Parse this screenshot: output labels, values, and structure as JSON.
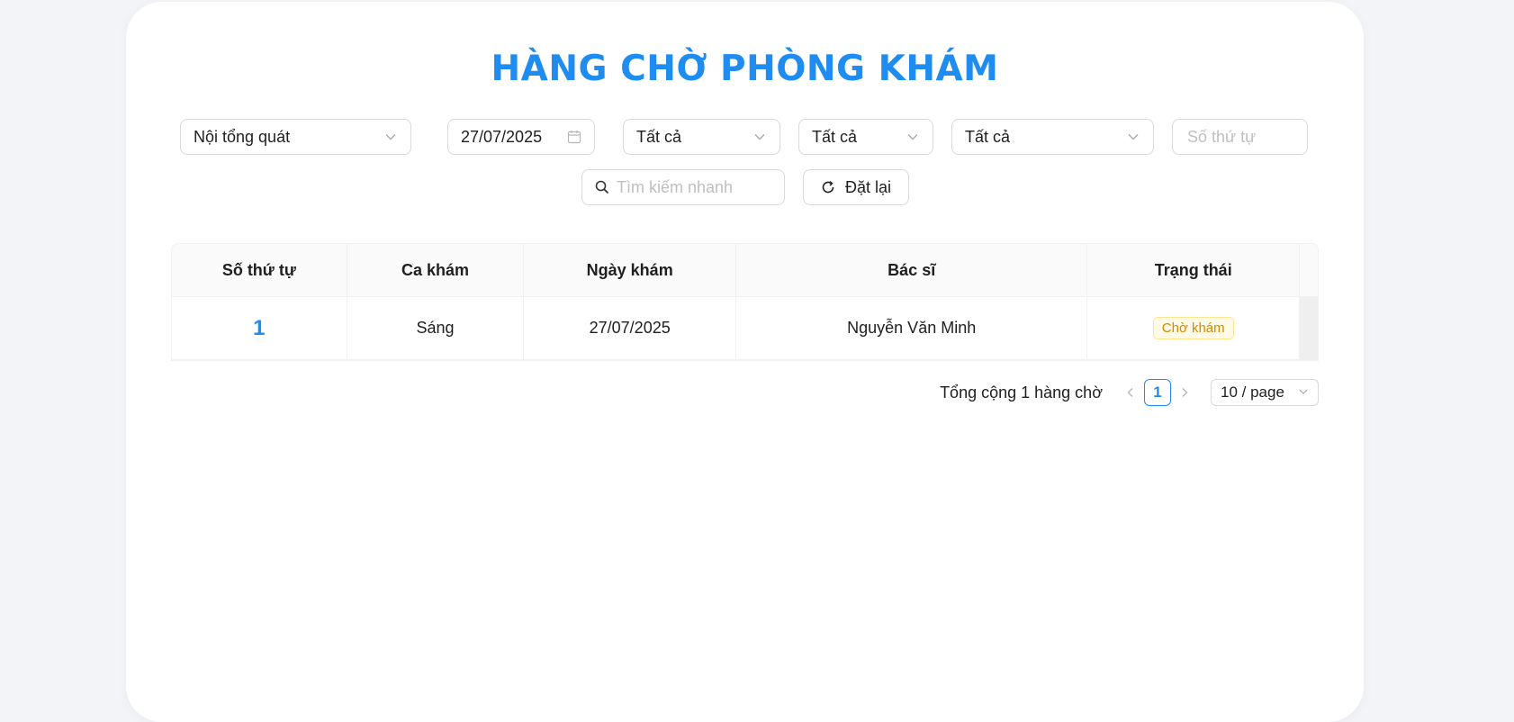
{
  "page": {
    "title": "HÀNG CHỜ PHÒNG KHÁM"
  },
  "filters": {
    "department": {
      "value": "Nội tổng quát",
      "icon": "chevron-down-icon"
    },
    "date": {
      "value": "27/07/2025",
      "icon": "calendar-icon"
    },
    "filter_a": {
      "value": "Tất cả",
      "icon": "chevron-down-icon"
    },
    "filter_b": {
      "value": "Tất cả",
      "icon": "chevron-down-icon"
    },
    "filter_c": {
      "value": "Tất cả",
      "icon": "chevron-down-icon"
    },
    "queue_number": {
      "placeholder": "Số thứ tự",
      "value": ""
    },
    "search": {
      "placeholder": "Tìm kiếm nhanh",
      "value": "",
      "icon": "search-icon"
    },
    "reset_label": "Đặt lại"
  },
  "table": {
    "columns": [
      "Số thứ tự",
      "Ca khám",
      "Ngày khám",
      "Bác sĩ",
      "Trạng thái"
    ],
    "rows": [
      {
        "number": "1",
        "shift": "Sáng",
        "date": "27/07/2025",
        "doctor": "Nguyễn Văn Minh",
        "status": "Chờ khám"
      }
    ]
  },
  "pagination": {
    "total_text": "Tổng cộng 1 hàng chờ",
    "current_page": "1",
    "page_size": "10 / page"
  },
  "colors": {
    "accent": "#1e8cf0",
    "status_waiting_text": "#d48806",
    "status_waiting_bg": "#fffbe6",
    "status_waiting_border": "#ffe58f",
    "page_bg": "#f3f4f8"
  }
}
